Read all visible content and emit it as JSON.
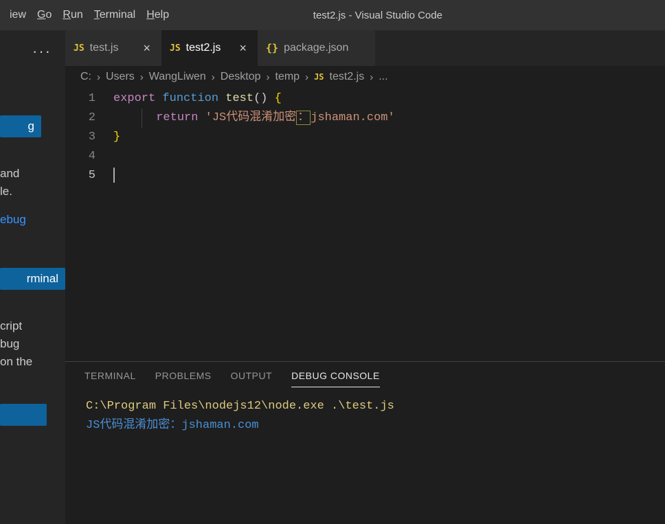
{
  "window_title": "test2.js - Visual Studio Code",
  "menu": {
    "view": "iew",
    "go": "Go",
    "run": "Run",
    "terminal": "Terminal",
    "help": "Help"
  },
  "tabs": [
    {
      "icon": "JS",
      "label": "test.js",
      "active": false,
      "close": true
    },
    {
      "icon": "JS",
      "label": "test2.js",
      "active": true,
      "close": true
    },
    {
      "icon": "{}",
      "label": "package.json",
      "active": false,
      "close": false
    }
  ],
  "breadcrumbs": {
    "parts": [
      "C:",
      "Users",
      "WangLiwen",
      "Desktop",
      "temp"
    ],
    "file_icon": "JS",
    "file": "test2.js",
    "tail": "..."
  },
  "editor": {
    "lines": [
      "1",
      "2",
      "3",
      "4",
      "5"
    ],
    "code": {
      "l1": {
        "export": "export",
        "function": "function",
        "name": "test",
        "parens": "()",
        "brace": "{"
      },
      "l2": {
        "return": "return",
        "str_pre": "'JS代码混淆加密",
        "str_hl": "：",
        "str_post": "jshaman.com'"
      },
      "l3": {
        "brace": "}"
      }
    }
  },
  "sidebar": {
    "btn1": "g",
    "text1a": "and",
    "text1b": "le.",
    "link1": "ebug",
    "btn2": "rminal",
    "text2a": "cript",
    "text2b": "bug",
    "text2c": "on the"
  },
  "panel": {
    "tabs": {
      "terminal": "TERMINAL",
      "problems": "PROBLEMS",
      "output": "OUTPUT",
      "debug": "DEBUG CONSOLE"
    },
    "console": {
      "cmd": "C:\\Program Files\\nodejs12\\node.exe .\\test.js",
      "out": "JS代码混淆加密：jshaman.com"
    }
  }
}
